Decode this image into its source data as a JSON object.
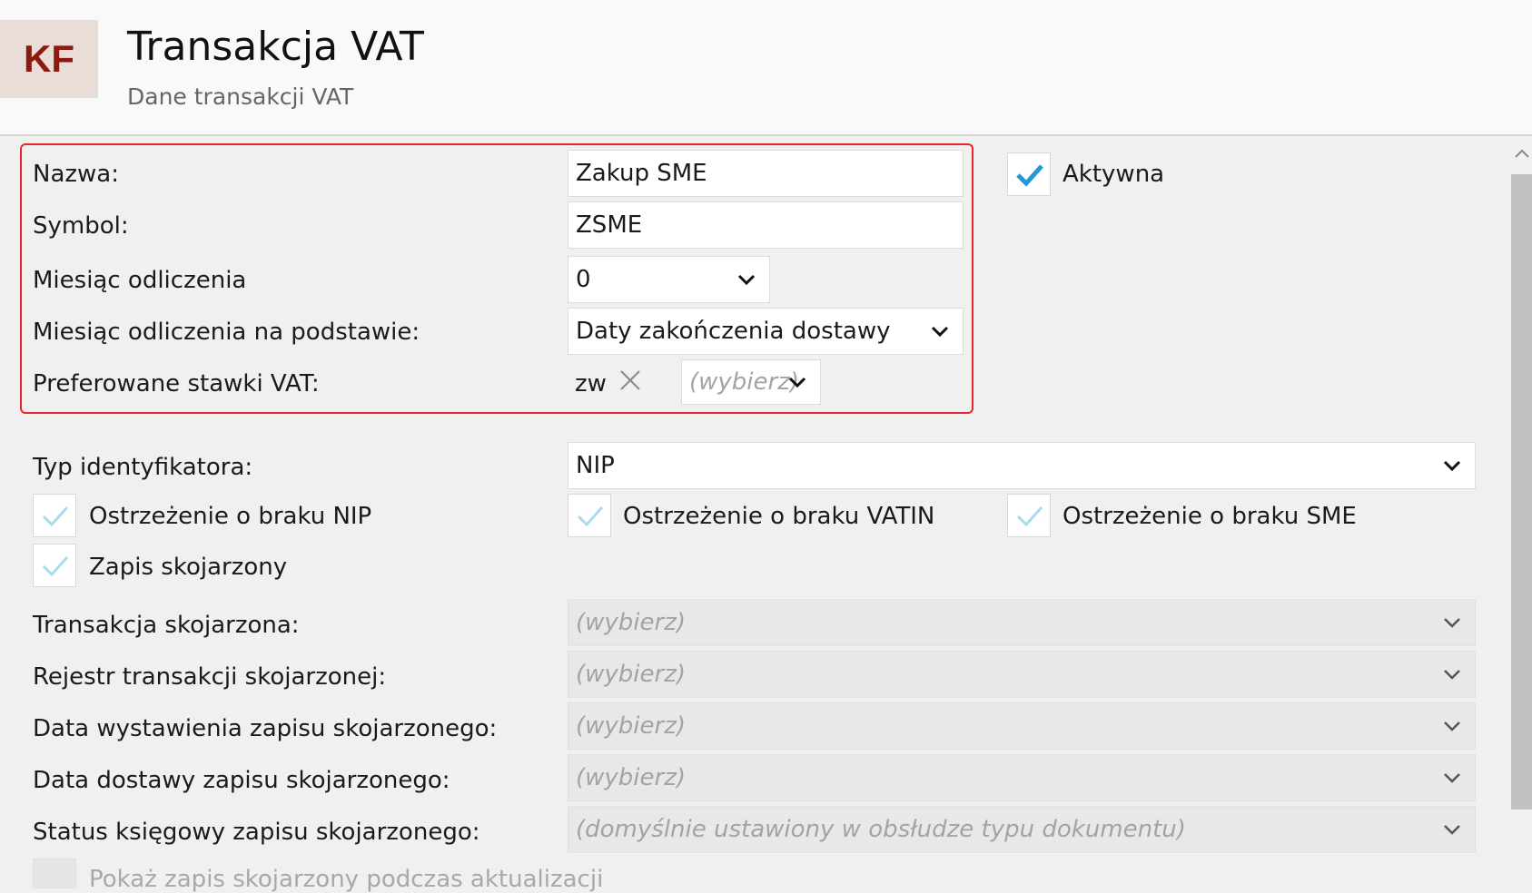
{
  "header": {
    "logo": "KF",
    "title": "Transakcja VAT",
    "subtitle": "Dane transakcji VAT"
  },
  "form": {
    "nazwa_label": "Nazwa:",
    "nazwa_value": "Zakup SME",
    "symbol_label": "Symbol:",
    "symbol_value": "ZSME",
    "miesiac_label": "Miesiąc odliczenia",
    "miesiac_value": "0",
    "podstawa_label": "Miesiąc odliczenia na podstawie:",
    "podstawa_value": "Daty zakończenia dostawy",
    "stawki_label": "Preferowane stawki VAT:",
    "stawki_tag": "zw",
    "stawki_select": "(wybierz)",
    "aktywna_label": "Aktywna",
    "aktywna_checked": true,
    "typ_label": "Typ identyfikatora:",
    "typ_value": "NIP",
    "ostrz_nip": "Ostrzeżenie o braku NIP",
    "ostrz_vatin": "Ostrzeżenie o braku VATIN",
    "ostrz_sme": "Ostrzeżenie o braku SME",
    "zapis_skojarzony": "Zapis skojarzony",
    "transakcja_skoj_label": "Transakcja skojarzona:",
    "transakcja_skoj_value": "(wybierz)",
    "rejestr_label": "Rejestr transakcji skojarzonej:",
    "rejestr_value": "(wybierz)",
    "data_wyst_label": "Data wystawienia zapisu skojarzonego:",
    "data_wyst_value": "(wybierz)",
    "data_dost_label": "Data dostawy zapisu skojarzonego:",
    "data_dost_value": "(wybierz)",
    "status_label": "Status księgowy zapisu skojarzonego:",
    "status_value": "(domyślnie ustawiony w obsłudze typu dokumentu)",
    "pokaz_label": "Pokaż zapis skojarzony podczas aktualizacji"
  },
  "colors": {
    "accent_check": "#1e9bd7",
    "light_check": "#a7dcef",
    "highlight_border": "#e8242c",
    "logo_text": "#8b1a10"
  }
}
